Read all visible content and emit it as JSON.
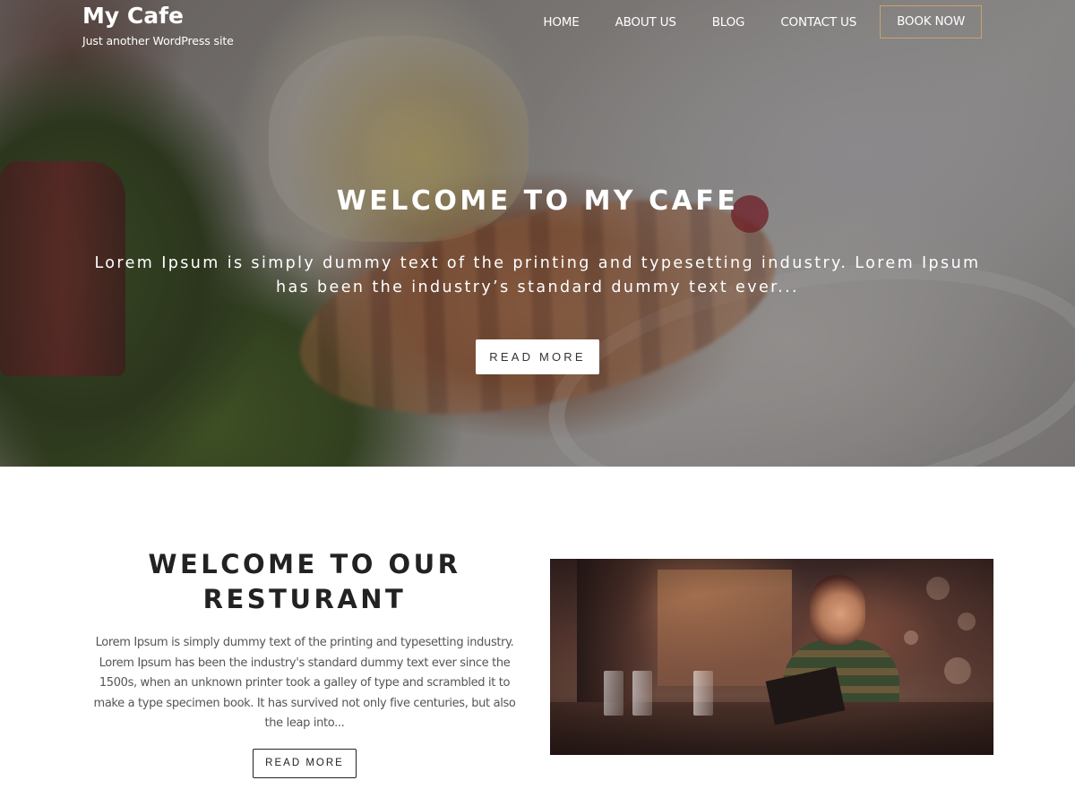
{
  "site": {
    "title": "My Cafe",
    "tagline": "Just another WordPress site"
  },
  "nav": {
    "items": [
      {
        "label": "HOME"
      },
      {
        "label": "ABOUT US"
      },
      {
        "label": "BLOG"
      },
      {
        "label": "CONTACT US"
      }
    ],
    "book_label": "BOOK NOW",
    "book_border_color": "#c9a36a"
  },
  "hero": {
    "heading": "WELCOME TO MY CAFE",
    "text": "Lorem Ipsum is simply dummy text of the printing and typesetting industry. Lorem Ipsum has been the industry’s standard dummy text ever...",
    "button_label": "READ MORE"
  },
  "about": {
    "heading": "WELCOME TO OUR RESTURANT",
    "body": "Lorem Ipsum is simply dummy text of the printing and typesetting industry. Lorem Ipsum has been the industry's standard dummy text ever since the 1500s, when an unknown printer took a galley of type and scrambled it to make a type specimen book. It has survived not only five centuries, but also the leap into...",
    "button_label": "READ MORE"
  }
}
